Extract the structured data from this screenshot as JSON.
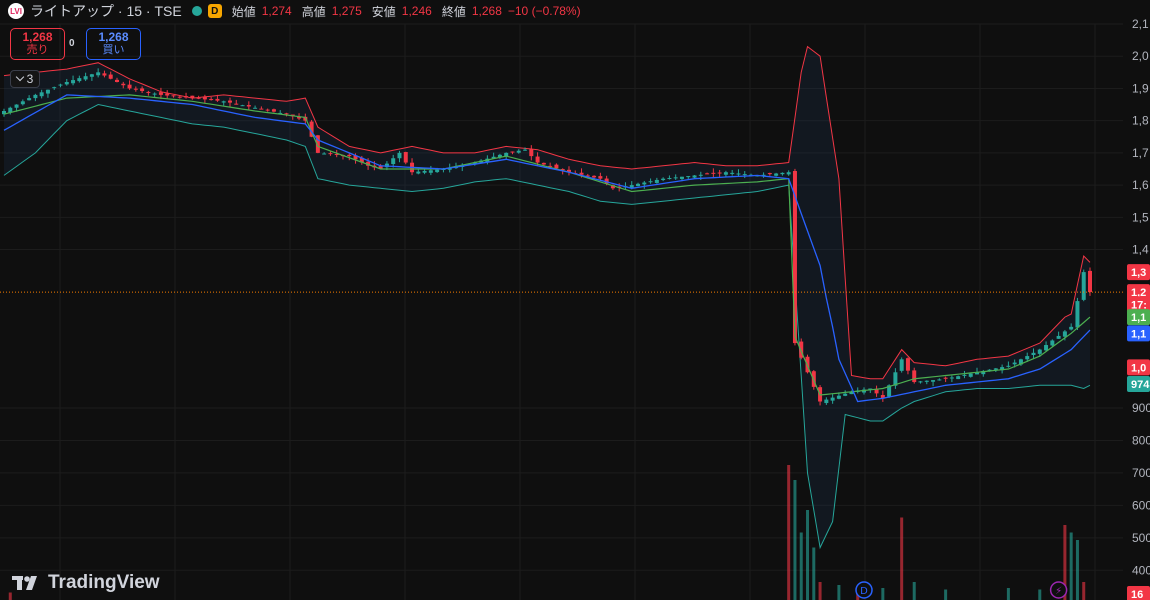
{
  "header": {
    "logo_text": "LVI",
    "symbol": "ライトアップ · 15 · TSE",
    "badge": "D",
    "open_label": "始値",
    "open": "1,274",
    "high_label": "高値",
    "high": "1,275",
    "low_label": "安値",
    "low": "1,246",
    "close_label": "終値",
    "close": "1,268",
    "change": "−10 (−0.78%)"
  },
  "trade": {
    "sell_price": "1,268",
    "sell_label": "売り",
    "spread": "0",
    "buy_price": "1,268",
    "buy_label": "買い"
  },
  "indicators_count": "3",
  "brand": "TradingView",
  "colors": {
    "up": "#26a69a",
    "down": "#f23645",
    "bb_upper": "#f23645",
    "bb_lower": "#26a69a",
    "ma_blue": "#2962ff",
    "ma_green": "#4caf50",
    "background": "#0f0f0f"
  },
  "chart_data": {
    "type": "candlestick",
    "y_axis_ticks": [
      "2,1",
      "2,0",
      "1,9",
      "1,8",
      "1,7",
      "1,6",
      "1,5",
      "1,4",
      "900",
      "800",
      "700",
      "600",
      "500",
      "400"
    ],
    "ylim": [
      400,
      2100
    ],
    "price_labels": [
      {
        "text": "1,3",
        "value": 1330,
        "color": "#f23645"
      },
      {
        "text": "1,2",
        "value": 1268,
        "color": "#f23645"
      },
      {
        "text": "17:",
        "value": 1230,
        "color": "#f23645"
      },
      {
        "text": "1,1",
        "value": 1180,
        "color": "#4caf50"
      },
      {
        "text": "1,1",
        "value": 1130,
        "color": "#2962ff"
      },
      {
        "text": "1,0",
        "value": 1025,
        "color": "#f23645"
      },
      {
        "text": "974",
        "value": 974,
        "color": "#26a69a"
      },
      {
        "text": "16",
        "value": 400,
        "color": "#f23645"
      }
    ],
    "current_price": 1268,
    "close_anchors": [
      [
        0,
        1830
      ],
      [
        5,
        1880
      ],
      [
        10,
        1920
      ],
      [
        15,
        1950
      ],
      [
        20,
        1900
      ],
      [
        25,
        1880
      ],
      [
        30,
        1870
      ],
      [
        35,
        1860
      ],
      [
        40,
        1840
      ],
      [
        45,
        1820
      ],
      [
        48,
        1800
      ],
      [
        50,
        1700
      ],
      [
        55,
        1690
      ],
      [
        58,
        1660
      ],
      [
        60,
        1650
      ],
      [
        63,
        1700
      ],
      [
        65,
        1640
      ],
      [
        70,
        1650
      ],
      [
        75,
        1670
      ],
      [
        80,
        1700
      ],
      [
        83,
        1710
      ],
      [
        85,
        1670
      ],
      [
        90,
        1640
      ],
      [
        95,
        1620
      ],
      [
        97,
        1590
      ],
      [
        100,
        1600
      ],
      [
        105,
        1620
      ],
      [
        110,
        1630
      ],
      [
        115,
        1640
      ],
      [
        120,
        1630
      ],
      [
        125,
        1640
      ],
      [
        126,
        1100
      ],
      [
        130,
        920
      ],
      [
        135,
        950
      ],
      [
        138,
        960
      ],
      [
        140,
        930
      ],
      [
        143,
        1050
      ],
      [
        145,
        980
      ],
      [
        150,
        990
      ],
      [
        155,
        1010
      ],
      [
        160,
        1030
      ],
      [
        165,
        1080
      ],
      [
        170,
        1150
      ],
      [
        172,
        1330
      ],
      [
        173,
        1268
      ]
    ],
    "bollinger": {
      "upper": [
        [
          0,
          1940
        ],
        [
          5,
          1950
        ],
        [
          10,
          1960
        ],
        [
          15,
          1980
        ],
        [
          20,
          1930
        ],
        [
          25,
          1890
        ],
        [
          30,
          1870
        ],
        [
          35,
          1880
        ],
        [
          40,
          1870
        ],
        [
          45,
          1860
        ],
        [
          48,
          1870
        ],
        [
          50,
          1780
        ],
        [
          55,
          1720
        ],
        [
          60,
          1700
        ],
        [
          65,
          1720
        ],
        [
          70,
          1700
        ],
        [
          75,
          1700
        ],
        [
          80,
          1720
        ],
        [
          85,
          1710
        ],
        [
          90,
          1680
        ],
        [
          95,
          1660
        ],
        [
          100,
          1650
        ],
        [
          105,
          1660
        ],
        [
          110,
          1670
        ],
        [
          115,
          1660
        ],
        [
          120,
          1660
        ],
        [
          125,
          1670
        ],
        [
          127,
          1950
        ],
        [
          128,
          2030
        ],
        [
          130,
          2000
        ],
        [
          133,
          1620
        ],
        [
          135,
          1000
        ],
        [
          138,
          990
        ],
        [
          140,
          990
        ],
        [
          143,
          1080
        ],
        [
          145,
          1040
        ],
        [
          150,
          1030
        ],
        [
          155,
          1050
        ],
        [
          160,
          1060
        ],
        [
          165,
          1100
        ],
        [
          170,
          1200
        ],
        [
          172,
          1380
        ],
        [
          173,
          1360
        ]
      ],
      "lower": [
        [
          0,
          1630
        ],
        [
          5,
          1700
        ],
        [
          10,
          1800
        ],
        [
          15,
          1850
        ],
        [
          20,
          1830
        ],
        [
          25,
          1810
        ],
        [
          30,
          1790
        ],
        [
          35,
          1780
        ],
        [
          40,
          1760
        ],
        [
          45,
          1740
        ],
        [
          48,
          1720
        ],
        [
          50,
          1620
        ],
        [
          55,
          1600
        ],
        [
          60,
          1590
        ],
        [
          65,
          1580
        ],
        [
          70,
          1590
        ],
        [
          75,
          1610
        ],
        [
          80,
          1620
        ],
        [
          85,
          1600
        ],
        [
          90,
          1580
        ],
        [
          95,
          1550
        ],
        [
          100,
          1540
        ],
        [
          105,
          1550
        ],
        [
          110,
          1560
        ],
        [
          115,
          1570
        ],
        [
          120,
          1580
        ],
        [
          125,
          1600
        ],
        [
          127,
          1000
        ],
        [
          128,
          700
        ],
        [
          130,
          470
        ],
        [
          132,
          550
        ],
        [
          134,
          880
        ],
        [
          138,
          860
        ],
        [
          140,
          860
        ],
        [
          143,
          900
        ],
        [
          145,
          920
        ],
        [
          150,
          950
        ],
        [
          155,
          960
        ],
        [
          160,
          960
        ],
        [
          165,
          970
        ],
        [
          170,
          970
        ],
        [
          172,
          960
        ],
        [
          173,
          970
        ]
      ]
    },
    "ma_blue": [
      [
        0,
        1770
      ],
      [
        10,
        1880
      ],
      [
        20,
        1870
      ],
      [
        30,
        1850
      ],
      [
        40,
        1810
      ],
      [
        48,
        1790
      ],
      [
        50,
        1740
      ],
      [
        60,
        1660
      ],
      [
        70,
        1650
      ],
      [
        80,
        1680
      ],
      [
        90,
        1640
      ],
      [
        100,
        1590
      ],
      [
        110,
        1620
      ],
      [
        120,
        1630
      ],
      [
        125,
        1620
      ],
      [
        130,
        1350
      ],
      [
        133,
        1050
      ],
      [
        136,
        920
      ],
      [
        140,
        930
      ],
      [
        145,
        950
      ],
      [
        150,
        970
      ],
      [
        160,
        990
      ],
      [
        165,
        1020
      ],
      [
        170,
        1080
      ],
      [
        173,
        1140
      ]
    ],
    "ma_green": [
      [
        0,
        1820
      ],
      [
        10,
        1870
      ],
      [
        20,
        1880
      ],
      [
        30,
        1860
      ],
      [
        40,
        1830
      ],
      [
        48,
        1810
      ],
      [
        50,
        1720
      ],
      [
        60,
        1650
      ],
      [
        70,
        1650
      ],
      [
        80,
        1690
      ],
      [
        90,
        1640
      ],
      [
        100,
        1580
      ],
      [
        110,
        1600
      ],
      [
        120,
        1610
      ],
      [
        125,
        1620
      ],
      [
        126,
        1120
      ],
      [
        130,
        940
      ],
      [
        135,
        950
      ],
      [
        140,
        960
      ],
      [
        145,
        990
      ],
      [
        150,
        1000
      ],
      [
        160,
        1020
      ],
      [
        165,
        1060
      ],
      [
        170,
        1130
      ],
      [
        173,
        1180
      ]
    ],
    "volume": [
      {
        "i": 1,
        "v": 0.05,
        "up": false
      },
      {
        "i": 125,
        "v": 0.9,
        "up": false
      },
      {
        "i": 126,
        "v": 0.8,
        "up": true
      },
      {
        "i": 127,
        "v": 0.45,
        "up": true
      },
      {
        "i": 128,
        "v": 0.6,
        "up": true
      },
      {
        "i": 129,
        "v": 0.35,
        "up": true
      },
      {
        "i": 130,
        "v": 0.12,
        "up": false
      },
      {
        "i": 133,
        "v": 0.1,
        "up": true
      },
      {
        "i": 136,
        "v": 0.09,
        "up": false
      },
      {
        "i": 140,
        "v": 0.08,
        "up": true
      },
      {
        "i": 143,
        "v": 0.55,
        "up": false
      },
      {
        "i": 145,
        "v": 0.12,
        "up": true
      },
      {
        "i": 150,
        "v": 0.07,
        "up": true
      },
      {
        "i": 160,
        "v": 0.08,
        "up": true
      },
      {
        "i": 165,
        "v": 0.07,
        "up": true
      },
      {
        "i": 169,
        "v": 0.5,
        "up": false
      },
      {
        "i": 170,
        "v": 0.45,
        "up": true
      },
      {
        "i": 171,
        "v": 0.4,
        "up": true
      },
      {
        "i": 172,
        "v": 0.12,
        "up": false
      }
    ],
    "events": [
      {
        "i": 137,
        "label": "D",
        "color": "#2962ff"
      },
      {
        "i": 168,
        "label": "⚡",
        "color": "#9c27b0"
      }
    ]
  }
}
